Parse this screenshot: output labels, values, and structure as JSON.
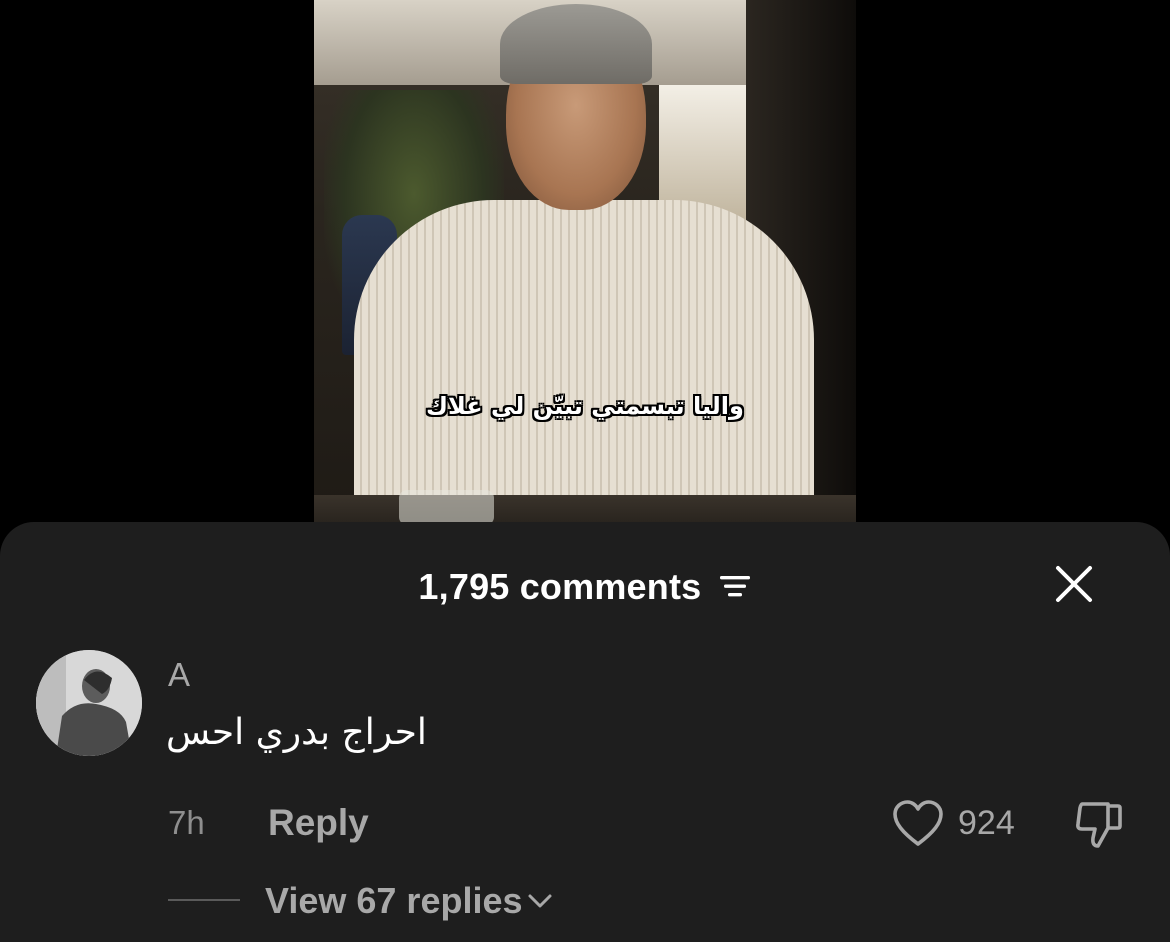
{
  "video": {
    "caption": "واليا تبسمتي تبيّن لي غلاك"
  },
  "comments_header": {
    "title": "1,795 comments",
    "sort_icon": "sort-filter-icon",
    "close_icon": "close-icon"
  },
  "comment": {
    "username": "A",
    "text": "احراج بدري احس",
    "time": "7h",
    "reply_label": "Reply",
    "like_count": "924",
    "view_replies_label": "View 67 replies",
    "avatar_icon": "avatar-photo"
  },
  "colors": {
    "sheet_background": "#1e1e1e",
    "secondary_text": "#a8a8a8",
    "primary_text": "#ffffff"
  }
}
